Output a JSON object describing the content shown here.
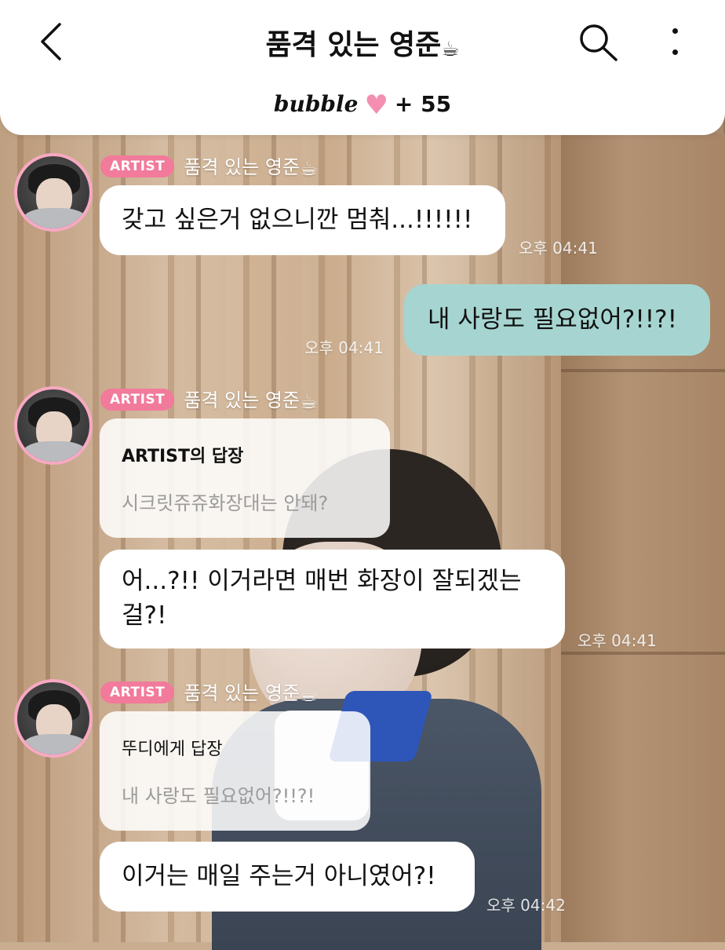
{
  "header": {
    "title": "품격 있는 영준",
    "title_emoji": "☕",
    "brand": "bubble",
    "brand_count": "+ 55"
  },
  "messages": [
    {
      "sender_badge": "ARTIST",
      "sender_name": "품격 있는 영준",
      "sender_emoji": "☕",
      "text": "갖고 싶은거 없으니깐 멈춰...!!!!!!",
      "time": "오후 04:41"
    },
    {
      "mine": true,
      "text": "내 사랑도 필요없어?!!?!",
      "time": "오후 04:41"
    },
    {
      "sender_badge": "ARTIST",
      "sender_name": "품격 있는 영준",
      "sender_emoji": "☕",
      "reply_header": "ARTIST의 답장",
      "reply_quote": "시크릿쥬쥬화장대는 안돼?",
      "text_line1": "어...?!! 이거라면 매번 화장이 잘되겠는",
      "text_line2": "걸?!",
      "time": "오후 04:41"
    },
    {
      "sender_badge": "ARTIST",
      "sender_name": "품격 있는 영준",
      "sender_emoji": "☕",
      "reply_header": "뚜디에게 답장",
      "reply_quote": "내 사랑도 필요없어?!!?!",
      "text": "이거는 매일 주는거 아니였어?!",
      "time": "오후 04:42"
    }
  ],
  "icons": {
    "back": "chevron-left-icon",
    "search": "search-icon",
    "more": "more-vertical-icon",
    "heart": "heart-icon"
  },
  "colors": {
    "artist_badge": "#f27a9b",
    "my_bubble": "#a6d5d1",
    "avatar_ring": "#f7a9c2",
    "heart": "#f48fb1"
  }
}
